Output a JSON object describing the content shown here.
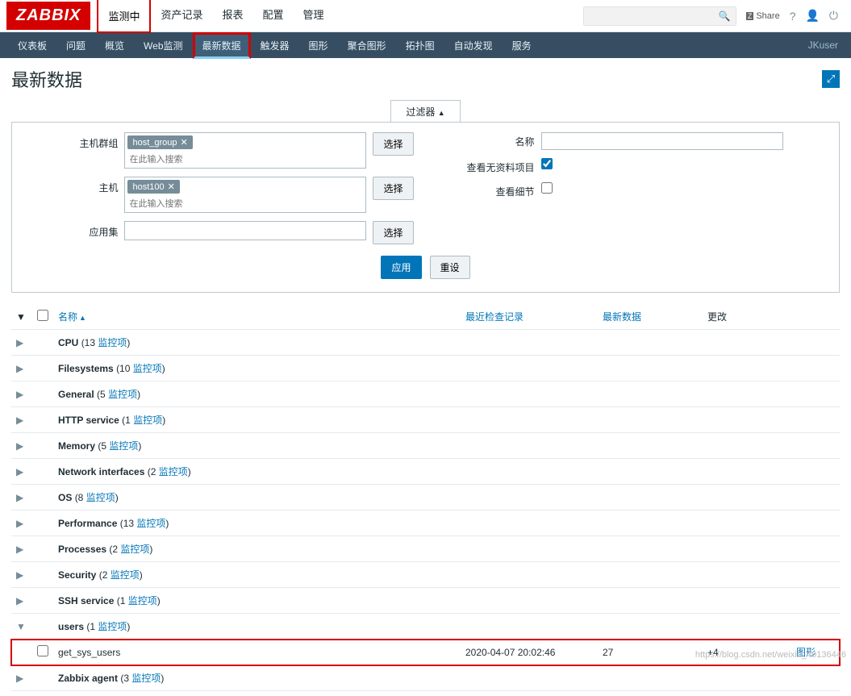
{
  "logo": "ZABBIX",
  "topnav": [
    "监测中",
    "资产记录",
    "报表",
    "配置",
    "管理"
  ],
  "topnav_selected": 0,
  "share_label": "Share",
  "subnav": [
    "仪表板",
    "问题",
    "概览",
    "Web监测",
    "最新数据",
    "触发器",
    "图形",
    "聚合图形",
    "拓扑图",
    "自动发现",
    "服务"
  ],
  "subnav_selected": 4,
  "user_label": "JKuser",
  "page_title": "最新数据",
  "filter": {
    "tab_label": "过滤器",
    "hostgroup_label": "主机群组",
    "hostgroup_tag": "host_group",
    "host_label": "主机",
    "host_tag": "host100",
    "appset_label": "应用集",
    "search_placeholder": "在此输入搜索",
    "select_btn": "选择",
    "name_label": "名称",
    "noitems_label": "查看无资料项目",
    "noitems_checked": true,
    "details_label": "查看细节",
    "details_checked": false,
    "apply_btn": "应用",
    "reset_btn": "重设"
  },
  "columns": {
    "name": "名称",
    "last_check": "最近检查记录",
    "last_data": "最新数据",
    "change": "更改"
  },
  "categories": [
    {
      "name": "CPU",
      "count": 13,
      "expanded": false
    },
    {
      "name": "Filesystems",
      "count": 10,
      "expanded": false
    },
    {
      "name": "General",
      "count": 5,
      "expanded": false
    },
    {
      "name": "HTTP service",
      "count": 1,
      "expanded": false
    },
    {
      "name": "Memory",
      "count": 5,
      "expanded": false
    },
    {
      "name": "Network interfaces",
      "count": 2,
      "expanded": false
    },
    {
      "name": "OS",
      "count": 8,
      "expanded": false
    },
    {
      "name": "Performance",
      "count": 13,
      "expanded": false
    },
    {
      "name": "Processes",
      "count": 2,
      "expanded": false
    },
    {
      "name": "Security",
      "count": 2,
      "expanded": false
    },
    {
      "name": "SSH service",
      "count": 1,
      "expanded": false
    },
    {
      "name": "users",
      "count": 1,
      "expanded": true,
      "items": [
        {
          "name": "get_sys_users",
          "last_check": "2020-04-07 20:02:46",
          "last_data": "27",
          "change": "+4",
          "action": "图形",
          "highlight": true
        }
      ]
    },
    {
      "name": "Zabbix agent",
      "count": 3,
      "expanded": false
    }
  ],
  "monitor_item_word": "监控项",
  "footer_url": "https://blog.csdn.net/weixin_40136446"
}
